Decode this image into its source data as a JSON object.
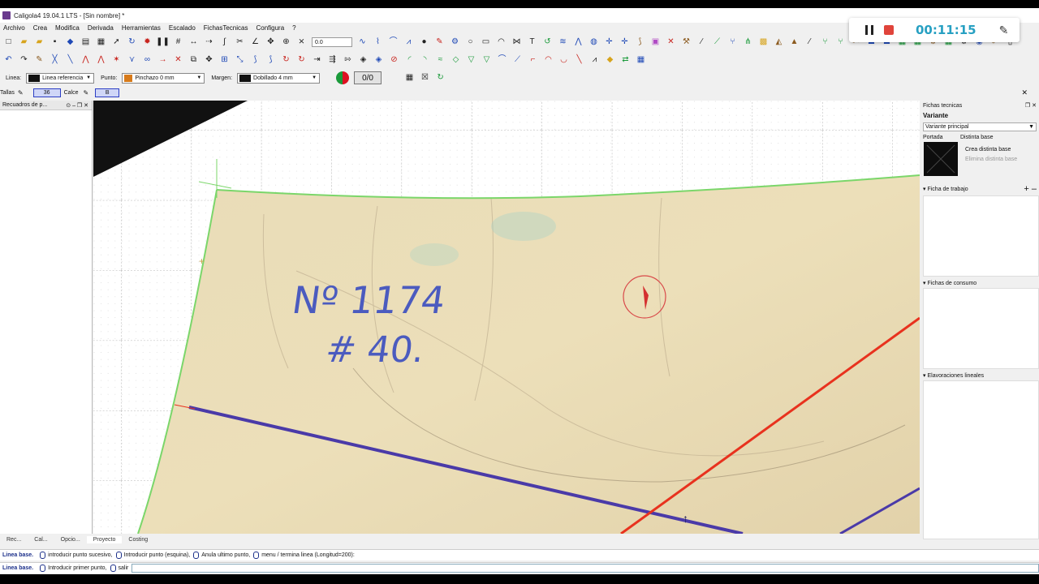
{
  "window": {
    "title": "Caligola4 19.04.1 LTS - [Sin nombre] *"
  },
  "menu": [
    "Archivo",
    "Crea",
    "Modifica",
    "Derivada",
    "Herramientas",
    "Escalado",
    "FichasTecnicas",
    "Configura",
    "?"
  ],
  "toolbar": {
    "angle_value": "0.0"
  },
  "propbar": {
    "linea_label": "Linea:",
    "linea_value": "Linea referencia",
    "punto_label": "Punto:",
    "punto_value": "Pinchazo 0 mm",
    "margen_label": "Margen:",
    "margen_value": "Dobillado 4 mm",
    "counter": "0/0"
  },
  "tallas": {
    "tallas_label": "Tallas",
    "talla_value": "36",
    "calce_label": "Calce",
    "calce_value": "B"
  },
  "left_panel": {
    "title": "Recuadros de p..."
  },
  "canvas": {
    "handwriting_line1": "Nº 1174",
    "handwriting_line2": "# 40."
  },
  "right_panel": {
    "title": "Fichas tecnicas",
    "variante_label": "Variante",
    "variante_value": "Variante principal",
    "portada_label": "Portada",
    "distinta_base_label": "Distinta base",
    "crea_distinta": "Crea distinta base",
    "elimina_distinta": "Elimina distinta base",
    "ficha_trabajo": "Ficha de trabajo",
    "fichas_consumo": "Fichas de consumo",
    "elavoraciones": "Elavoraciones lineales"
  },
  "bottom_tabs": [
    "Rec...",
    "Cal...",
    "Opcio...",
    "Proyecto",
    "Costing"
  ],
  "status": {
    "line1_bold": "Linea base.",
    "line1_a": "introducir punto sucesivo,",
    "line1_b": "Introducir punto (esquina),",
    "line1_c": "Anula ultimo punto,",
    "line1_d": "menu / termina linea (Longitud=200):",
    "line2_bold": "Linea base.",
    "line2_a": "Introducir primer punto,",
    "line2_b": "salir"
  },
  "recorder": {
    "time": "00:11:15"
  },
  "colors": {
    "accent_blue": "#2c3ec4",
    "record_red": "#e0443b",
    "timer_blue": "#27a0c2",
    "green_line": "#7bd66a",
    "purple_line": "#4a3aa8",
    "red_line": "#e8321e"
  }
}
